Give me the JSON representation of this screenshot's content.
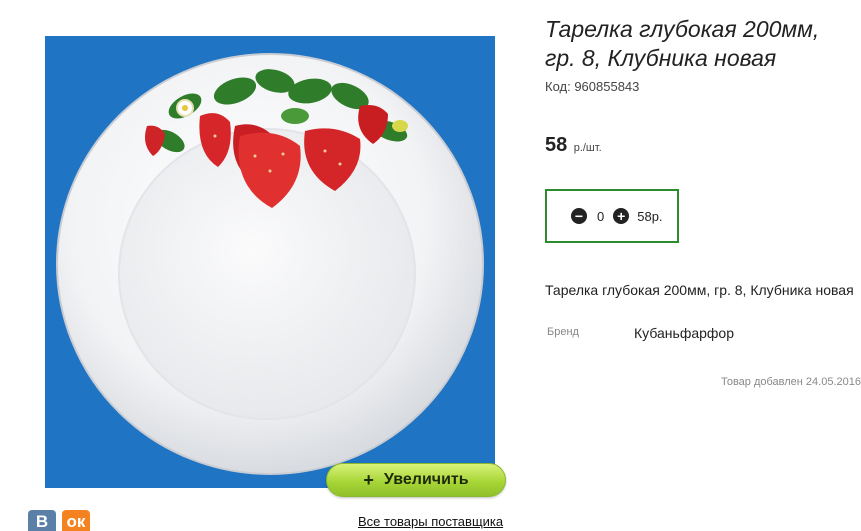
{
  "product": {
    "title": "Тарелка глубокая 200мм, гр. 8, Клубника новая",
    "code": "Код: 960855843",
    "price": "58",
    "price_unit": "р./шт.",
    "description": "Тарелка глубокая 200мм, гр. 8, Клубника новая",
    "brand_label": "Бренд",
    "brand_value": "Кубаньфарфор",
    "added": "Товар добавлен 24.05.2016"
  },
  "cart": {
    "quantity": "0",
    "total": "58р.",
    "minus_icon": "minus-circle-icon",
    "plus_icon": "plus-circle-icon",
    "border_color": "#2e8b2e"
  },
  "image": {
    "background_color": "#1f74c4",
    "zoom_label": "Увеличить",
    "zoom_icon": "plus-icon"
  },
  "social": {
    "vk_label": "В",
    "ok_label": "ок"
  },
  "links": {
    "supplier": "Все товары поставщика"
  }
}
